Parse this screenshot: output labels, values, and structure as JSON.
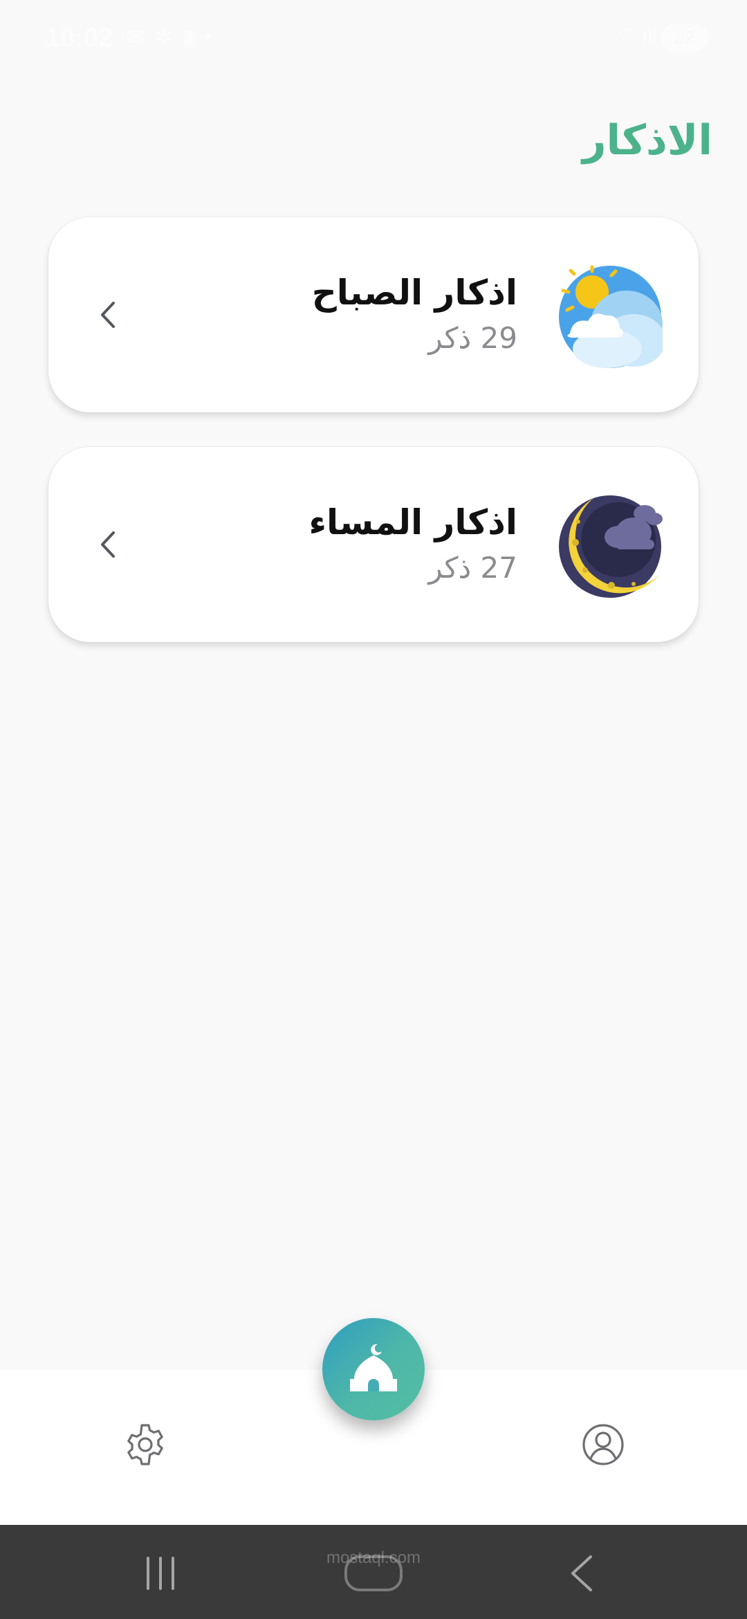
{
  "status_bar": {
    "time": "10:02",
    "battery": "32"
  },
  "header": {
    "title": "الاذكار"
  },
  "cards": [
    {
      "title": "اذكار الصباح",
      "subtitle": "29 ذكر",
      "icon": "morning-sun-cloud-icon"
    },
    {
      "title": "اذكار المساء",
      "subtitle": "27 ذكر",
      "icon": "evening-moon-cloud-icon"
    }
  ],
  "bottom_nav": {
    "items": [
      "settings-icon",
      "mosque-home-icon",
      "profile-icon"
    ]
  },
  "watermark": {
    "text": "mostaql.com"
  },
  "colors": {
    "accent": "#4cb28c",
    "fab_start": "#2f9ec0",
    "fab_end": "#53bea3",
    "system_nav": "#3a3a3a"
  }
}
